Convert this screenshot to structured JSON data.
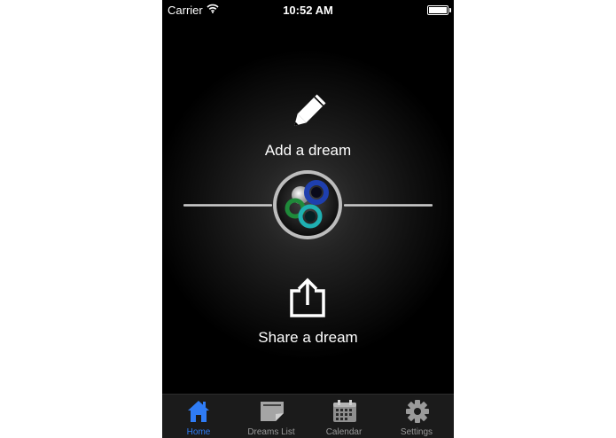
{
  "status_bar": {
    "carrier": "Carrier",
    "time": "10:52 AM"
  },
  "actions": {
    "add_label": "Add a dream",
    "share_label": "Share a dream"
  },
  "tab_bar": {
    "active_index": 0,
    "active_color": "#2f7cf6",
    "items": [
      {
        "label": "Home",
        "icon": "home-icon"
      },
      {
        "label": "Dreams List",
        "icon": "dreams-list-icon"
      },
      {
        "label": "Calendar",
        "icon": "calendar-icon"
      },
      {
        "label": "Settings",
        "icon": "settings-icon"
      }
    ]
  }
}
